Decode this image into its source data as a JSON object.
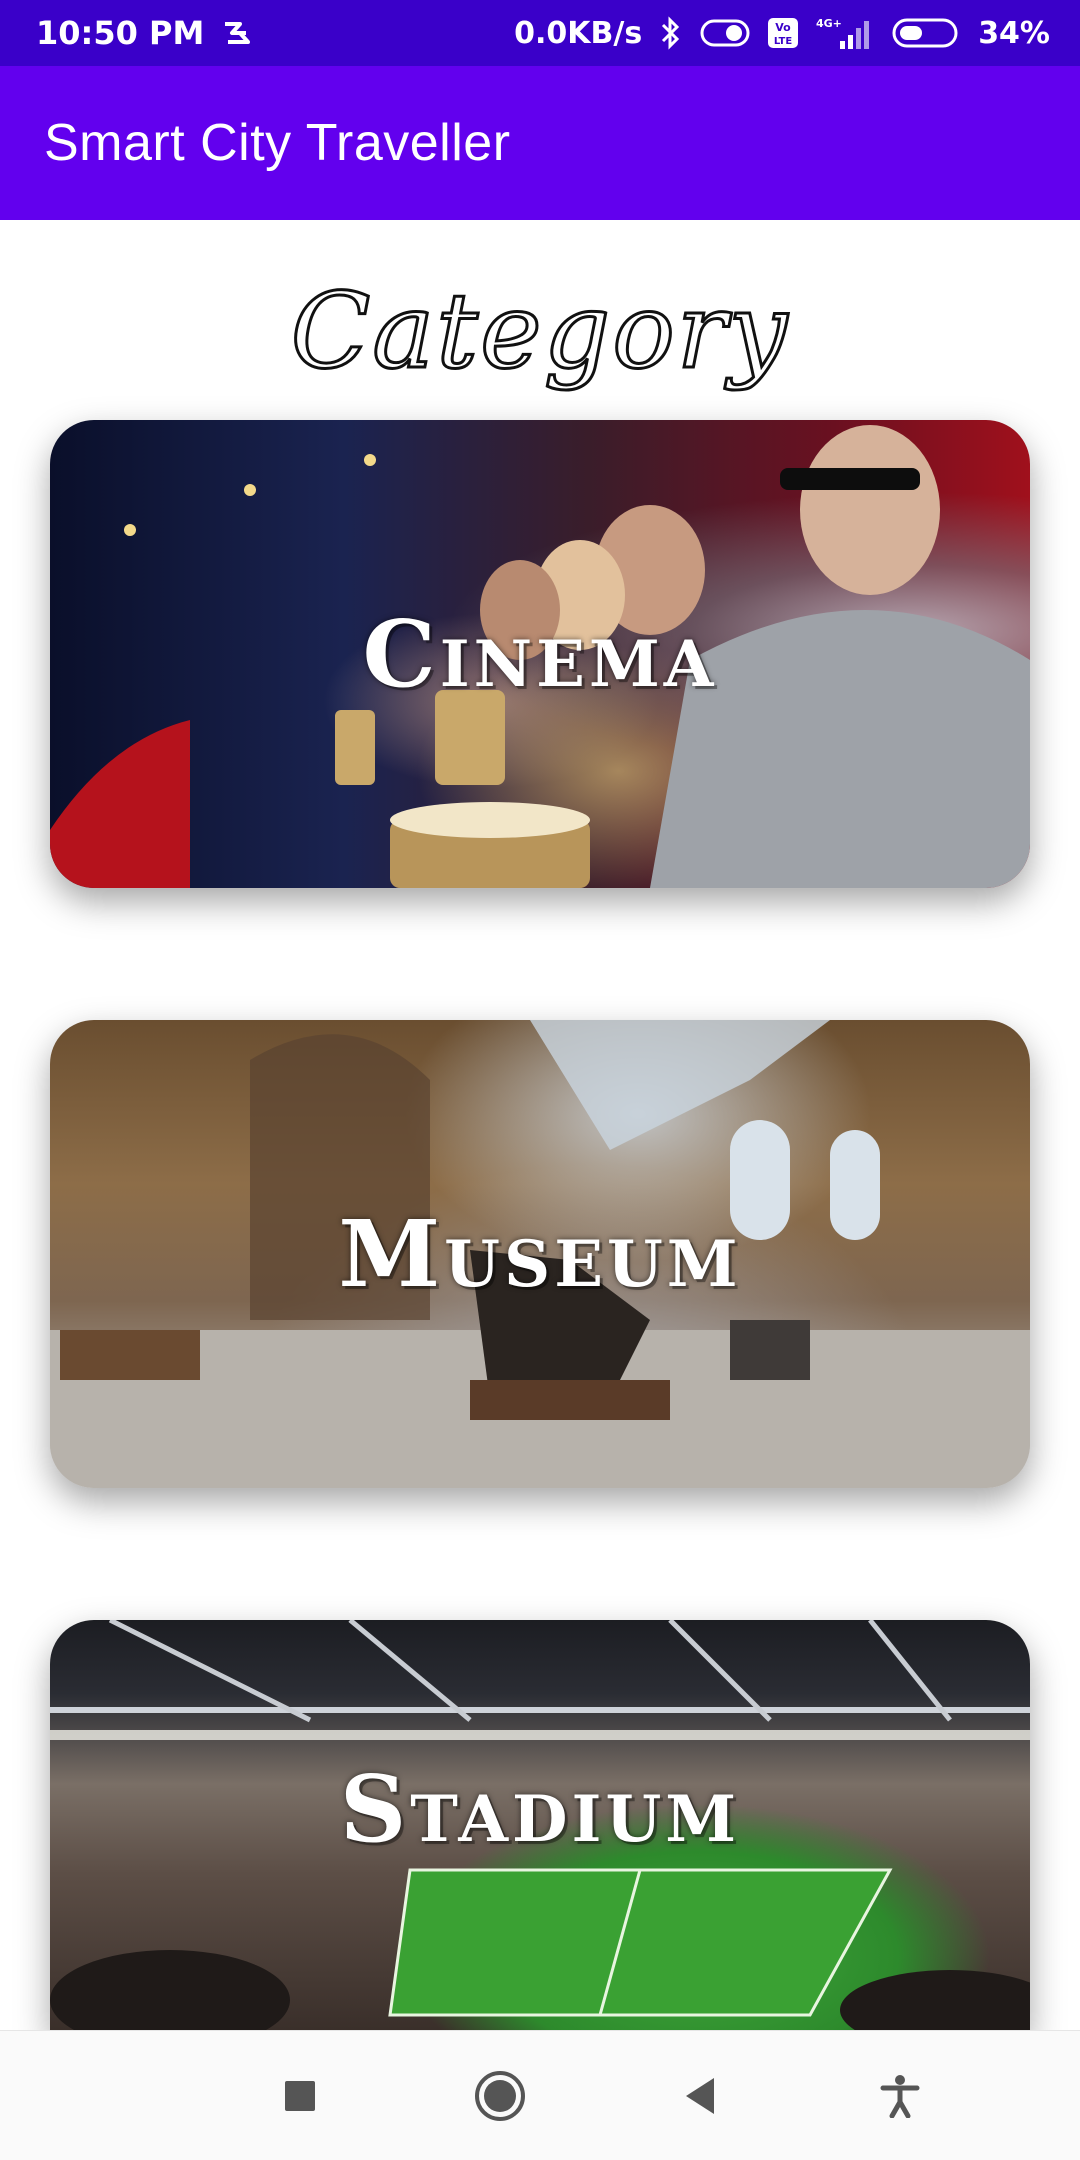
{
  "status_bar": {
    "time": "10:50 PM",
    "network_speed": "0.0KB/s",
    "network_type": "4G+",
    "battery": "34%",
    "icons": [
      "app-notification-icon",
      "bluetooth-icon",
      "toggle-icon",
      "volte-icon",
      "signal-icon",
      "battery-icon"
    ]
  },
  "app_bar": {
    "title": "Smart City Traveller"
  },
  "heading": "Category",
  "categories": [
    {
      "label": "Cinema"
    },
    {
      "label": "Museum"
    },
    {
      "label": "Stadium"
    }
  ],
  "nav_bar": {
    "icons": [
      "recents-icon",
      "home-icon",
      "back-icon",
      "accessibility-icon"
    ]
  },
  "colors": {
    "status_bar": "#3a00c9",
    "app_bar": "#6200ee",
    "background": "#ffffff"
  }
}
